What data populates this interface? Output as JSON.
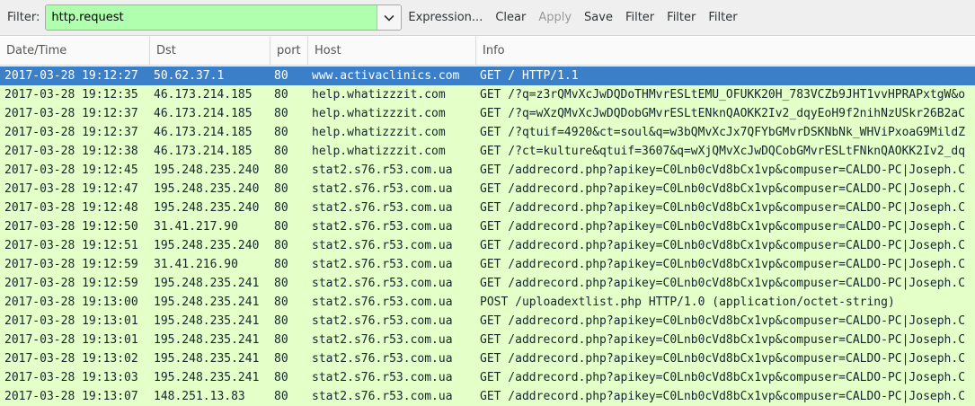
{
  "filter_bar": {
    "label": "Filter:",
    "value": "http.request",
    "buttons": [
      "Expression...",
      "Clear",
      "Apply",
      "Save",
      "Filter",
      "Filter",
      "Filter"
    ],
    "disabled_button": "Apply"
  },
  "columns": [
    "Date/Time",
    "Dst",
    "port",
    "Host",
    "Info"
  ],
  "packets": [
    {
      "time": "2017-03-28 19:12:27",
      "dst": "50.62.37.1",
      "port": "80",
      "host": "www.activaclinics.com",
      "info": "GET / HTTP/1.1",
      "selected": true
    },
    {
      "time": "2017-03-28 19:12:35",
      "dst": "46.173.214.185",
      "port": "80",
      "host": "help.whatizzzit.com",
      "info": "GET /?q=z3rQMvXcJwDQDoTHMvrESLtEMU_OFUKK20H_783VCZb9JHT1vvHPRAPxtgW&o"
    },
    {
      "time": "2017-03-28 19:12:37",
      "dst": "46.173.214.185",
      "port": "80",
      "host": "help.whatizzzit.com",
      "info": "GET /?q=wXzQMvXcJwDQDobGMvrESLtENknQAOKK2Iv2_dqyEoH9f2nihNzUSkr26B2aC"
    },
    {
      "time": "2017-03-28 19:12:37",
      "dst": "46.173.214.185",
      "port": "80",
      "host": "help.whatizzzit.com",
      "info": "GET /?qtuif=4920&ct=soul&q=w3bQMvXcJx7QFYbGMvrDSKNbNk_WHViPxoaG9MildZ"
    },
    {
      "time": "2017-03-28 19:12:38",
      "dst": "46.173.214.185",
      "port": "80",
      "host": "help.whatizzzit.com",
      "info": "GET /?ct=kulture&qtuif=3607&q=wXjQMvXcJwDQCobGMvrESLtFNknQAOKK2Iv2_dq"
    },
    {
      "time": "2017-03-28 19:12:45",
      "dst": "195.248.235.240",
      "port": "80",
      "host": "stat2.s76.r53.com.ua",
      "info": "GET /addrecord.php?apikey=C0Lnb0cVd8bCx1vp&compuser=CALDO-PC|Joseph.C"
    },
    {
      "time": "2017-03-28 19:12:47",
      "dst": "195.248.235.240",
      "port": "80",
      "host": "stat2.s76.r53.com.ua",
      "info": "GET /addrecord.php?apikey=C0Lnb0cVd8bCx1vp&compuser=CALDO-PC|Joseph.C"
    },
    {
      "time": "2017-03-28 19:12:48",
      "dst": "195.248.235.240",
      "port": "80",
      "host": "stat2.s76.r53.com.ua",
      "info": "GET /addrecord.php?apikey=C0Lnb0cVd8bCx1vp&compuser=CALDO-PC|Joseph.C"
    },
    {
      "time": "2017-03-28 19:12:50",
      "dst": "31.41.217.90",
      "port": "80",
      "host": "stat2.s76.r53.com.ua",
      "info": "GET /addrecord.php?apikey=C0Lnb0cVd8bCx1vp&compuser=CALDO-PC|Joseph.C"
    },
    {
      "time": "2017-03-28 19:12:51",
      "dst": "195.248.235.240",
      "port": "80",
      "host": "stat2.s76.r53.com.ua",
      "info": "GET /addrecord.php?apikey=C0Lnb0cVd8bCx1vp&compuser=CALDO-PC|Joseph.C"
    },
    {
      "time": "2017-03-28 19:12:59",
      "dst": "31.41.216.90",
      "port": "80",
      "host": "stat2.s76.r53.com.ua",
      "info": "GET /addrecord.php?apikey=C0Lnb0cVd8bCx1vp&compuser=CALDO-PC|Joseph.C"
    },
    {
      "time": "2017-03-28 19:12:59",
      "dst": "195.248.235.241",
      "port": "80",
      "host": "stat2.s76.r53.com.ua",
      "info": "GET /addrecord.php?apikey=C0Lnb0cVd8bCx1vp&compuser=CALDO-PC|Joseph.C"
    },
    {
      "time": "2017-03-28 19:13:00",
      "dst": "195.248.235.241",
      "port": "80",
      "host": "stat2.s76.r53.com.ua",
      "info": "POST /uploadextlist.php HTTP/1.0  (application/octet-string)"
    },
    {
      "time": "2017-03-28 19:13:01",
      "dst": "195.248.235.241",
      "port": "80",
      "host": "stat2.s76.r53.com.ua",
      "info": "GET /addrecord.php?apikey=C0Lnb0cVd8bCx1vp&compuser=CALDO-PC|Joseph.C"
    },
    {
      "time": "2017-03-28 19:13:01",
      "dst": "195.248.235.241",
      "port": "80",
      "host": "stat2.s76.r53.com.ua",
      "info": "GET /addrecord.php?apikey=C0Lnb0cVd8bCx1vp&compuser=CALDO-PC|Joseph.C"
    },
    {
      "time": "2017-03-28 19:13:02",
      "dst": "195.248.235.241",
      "port": "80",
      "host": "stat2.s76.r53.com.ua",
      "info": "GET /addrecord.php?apikey=C0Lnb0cVd8bCx1vp&compuser=CALDO-PC|Joseph.C"
    },
    {
      "time": "2017-03-28 19:13:03",
      "dst": "195.248.235.241",
      "port": "80",
      "host": "stat2.s76.r53.com.ua",
      "info": "GET /addrecord.php?apikey=C0Lnb0cVd8bCx1vp&compuser=CALDO-PC|Joseph.C"
    },
    {
      "time": "2017-03-28 19:13:07",
      "dst": "148.251.13.83",
      "port": "80",
      "host": "stat2.s76.r53.com.ua",
      "info": "GET /addrecord.php?apikey=C0Lnb0cVd8bCx1vp&compuser=CALDO-PC|Joseph.C"
    }
  ],
  "colors": {
    "filter_valid_bg": "#afffaf",
    "row_bg": "#e4ffc7",
    "selected_bg": "#3c7fc9"
  },
  "icons": {
    "dropdown": "chevron-down-icon"
  }
}
